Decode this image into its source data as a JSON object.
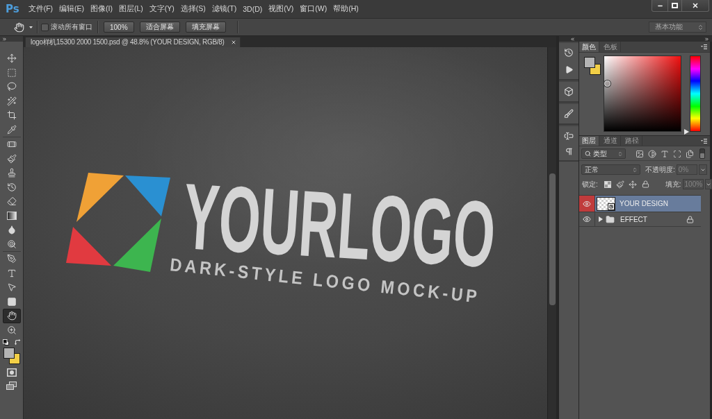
{
  "app": {
    "logo": "Ps"
  },
  "menu": [
    "文件(F)",
    "编辑(E)",
    "图像(I)",
    "图层(L)",
    "文字(Y)",
    "选择(S)",
    "滤镜(T)",
    "3D(D)",
    "视图(V)",
    "窗口(W)",
    "帮助(H)"
  ],
  "options_bar": {
    "scroll_all_windows": {
      "label": "滚动所有窗口",
      "checked": false
    },
    "buttons": [
      "100%",
      "适合屏幕",
      "填充屏幕"
    ],
    "workspace": "基本功能"
  },
  "toolbar": {
    "tool_groups": [
      {
        "tools": [
          {
            "selected": false
          },
          {
            "selected": false
          },
          {
            "selected": false
          },
          {
            "selected": false
          },
          {
            "selected": false
          },
          {
            "selected": false
          }
        ]
      },
      {
        "tools": [
          {
            "selected": false
          },
          {
            "selected": false
          },
          {
            "selected": false
          },
          {
            "selected": false
          },
          {
            "selected": false
          },
          {
            "selected": false
          },
          {
            "selected": false
          },
          {
            "selected": false
          }
        ]
      },
      {
        "tools": [
          {
            "selected": false
          },
          {
            "selected": false
          },
          {
            "selected": false
          },
          {
            "selected": false
          },
          {
            "selected": true
          },
          {
            "selected": false
          }
        ]
      }
    ],
    "swatches": [
      {
        "kind": "foreground",
        "color": "#b4b4b4"
      },
      {
        "kind": "background",
        "color": "#f2cf46"
      }
    ]
  },
  "document": {
    "tab_title": "logo样机15300 2000 1500.psd @ 48.8% (YOUR DESIGN, RGB/8)",
    "canvas": {
      "logo_text": "YOURLOGO",
      "tagline": "DARK-STYLE LOGO MOCK-UP"
    }
  },
  "color_panel": {
    "tabs": [
      {
        "label": "颜色",
        "selected": true
      },
      {
        "label": "色板",
        "selected": false
      }
    ],
    "swatches": [
      {
        "kind": "foreground",
        "color": "#b4b4b4"
      },
      {
        "kind": "background",
        "color": "#f2cf46"
      }
    ],
    "hue_slider": {
      "level": 0
    }
  },
  "layers_panel": {
    "tabs": [
      {
        "label": "图层",
        "selected": true
      },
      {
        "label": "通道",
        "selected": false
      },
      {
        "label": "路径",
        "selected": false
      }
    ],
    "filter": {
      "label": "类型",
      "on": false
    },
    "blend_mode": "正常",
    "opacity": {
      "label": "不透明度:",
      "value": "0%",
      "disabled": true
    },
    "lock_label": "锁定:",
    "fill": {
      "label": "填充:",
      "value": "100%",
      "disabled": true
    },
    "layers": [
      {
        "name": "YOUR DESIGN",
        "kind": "smart-object",
        "visible": true,
        "selected": true,
        "locked": false,
        "color": "#c03b3c"
      },
      {
        "name": "EFFECT",
        "kind": "group",
        "visible": true,
        "selected": false,
        "locked": true,
        "expanded": false
      }
    ]
  }
}
